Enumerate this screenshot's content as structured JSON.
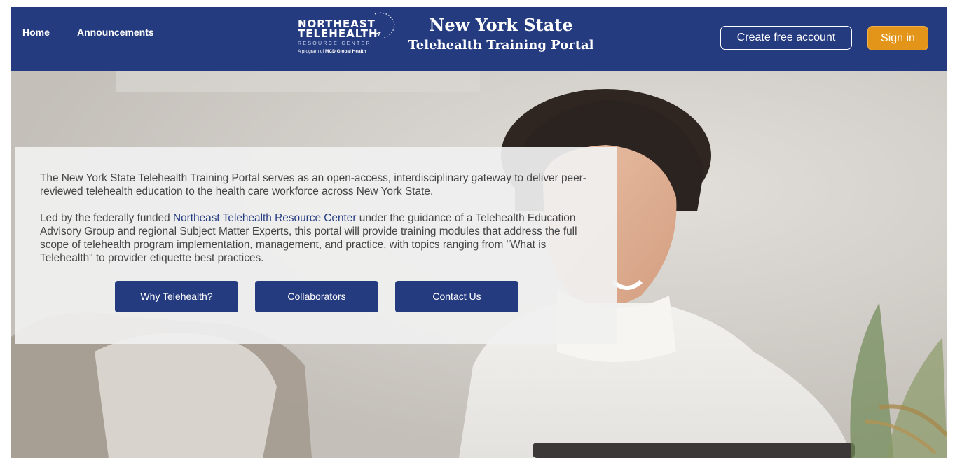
{
  "nav": {
    "home": "Home",
    "announcements": "Announcements"
  },
  "logo": {
    "line1": "NORTHEAST",
    "line2": "TELEHEALTH",
    "line3": "RESOURCE CENTER",
    "program_prefix": "A program of",
    "program_org": "MCD Global Health"
  },
  "title": {
    "line1": "New York State",
    "line2": "Telehealth Training Portal"
  },
  "auth": {
    "create_account": "Create free account",
    "sign_in": "Sign in"
  },
  "intro": {
    "paragraph1": "The New York State Telehealth Training Portal serves as an open-access, interdisciplinary gateway to deliver peer-reviewed telehealth education to the health care workforce across New York State.",
    "paragraph2_before": "Led by the federally funded ",
    "paragraph2_link": "Northeast Telehealth Resource Center",
    "paragraph2_after": " under the guidance of a Telehealth Education Advisory Group and regional Subject Matter Experts, this portal will provide training modules that address the full scope of telehealth program implementation, management, and practice, with topics ranging from \"What is Telehealth\" to provider etiquette best practices."
  },
  "buttons": {
    "why": "Why Telehealth?",
    "collaborators": "Collaborators",
    "contact": "Contact Us"
  },
  "colors": {
    "brand_navy": "#253b80",
    "accent_orange": "#e39519",
    "link_blue": "#253b80"
  },
  "icons": {
    "logo_mark": "dotted-arc-logo-mark",
    "hero_image": "woman-smiling-at-laptop-photo"
  }
}
